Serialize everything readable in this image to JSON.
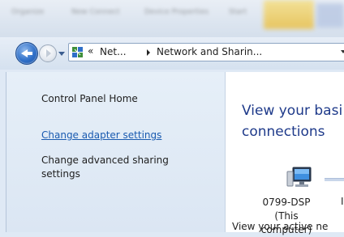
{
  "window": {
    "blurred_menu": [
      "Organize",
      "New Connect",
      "Device Properties",
      "Start"
    ],
    "colors": {
      "accent": "#1a5bb0",
      "heading": "#1e3a8a",
      "pane_bg": "#e1ebf6"
    }
  },
  "address_bar": {
    "overflow": "«",
    "segments": [
      "Net...",
      "Network and Sharin..."
    ],
    "location_icon": "control-panel-icon"
  },
  "sidebar": {
    "items": [
      {
        "label": "Control Panel Home",
        "link": false
      },
      {
        "label": "Change adapter settings",
        "link": true
      },
      {
        "label": "Change advanced sharing settings",
        "link": false
      }
    ]
  },
  "main": {
    "title_line1": "View your basi",
    "title_line2": "connections",
    "computer": {
      "name": "0799-DSP",
      "caption": "(This computer)",
      "icon": "computer-icon"
    },
    "next_item_partial": "I",
    "bottom_text": "View your active ne"
  }
}
